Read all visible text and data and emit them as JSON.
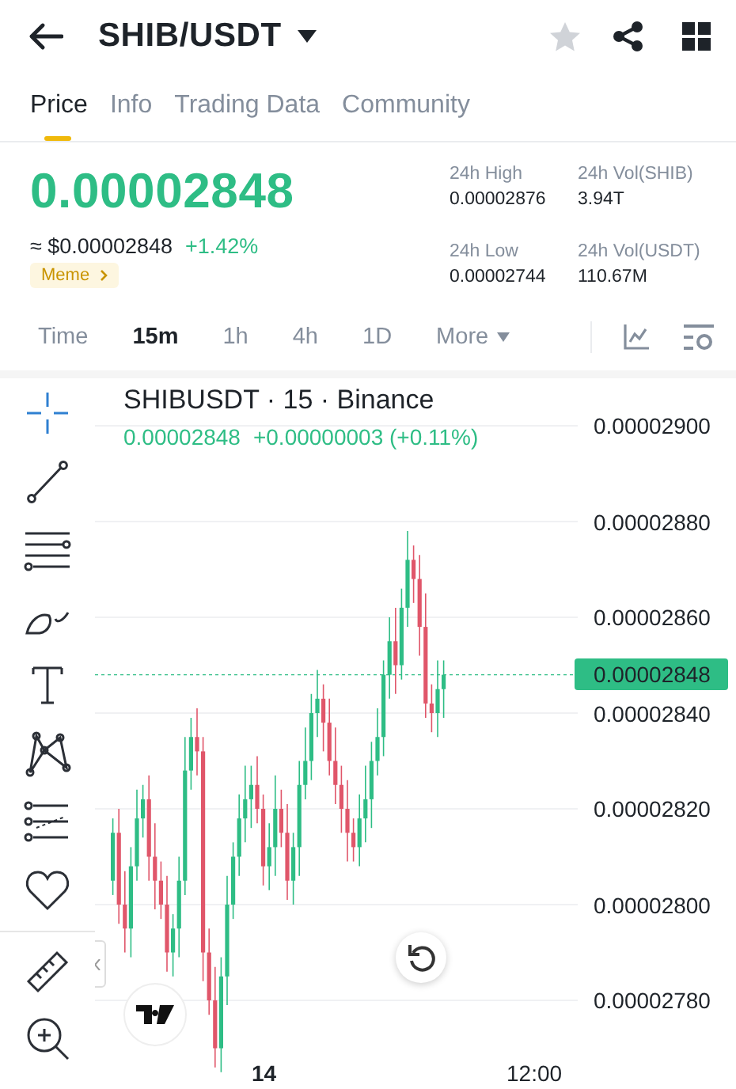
{
  "header": {
    "title": "SHIB/USDT",
    "favorite": false
  },
  "tabs": [
    {
      "label": "Price",
      "selected": true
    },
    {
      "label": "Info",
      "selected": false
    },
    {
      "label": "Trading Data",
      "selected": false
    },
    {
      "label": "Community",
      "selected": false
    }
  ],
  "price": {
    "last": "0.00002848",
    "fiat": "≈ $0.00002848",
    "change": "+1.42%",
    "tag": "Meme"
  },
  "stats": [
    {
      "label": "24h High",
      "value": "0.00002876"
    },
    {
      "label": "24h Vol(SHIB)",
      "value": "3.94T"
    },
    {
      "label": "24h Low",
      "value": "0.00002744"
    },
    {
      "label": "24h Vol(USDT)",
      "value": "110.67M"
    }
  ],
  "intervals": [
    {
      "label": "Time",
      "selected": false
    },
    {
      "label": "15m",
      "selected": true
    },
    {
      "label": "1h",
      "selected": false
    },
    {
      "label": "4h",
      "selected": false
    },
    {
      "label": "1D",
      "selected": false
    },
    {
      "label": "More",
      "selected": false
    }
  ],
  "chart": {
    "title": "SHIBUSDT · 15 · Binance",
    "last": "0.00002848",
    "change": "+0.00000003 (+0.11%)",
    "price_axis": [
      "0.00002900",
      "0.00002880",
      "0.00002860",
      "0.00002840",
      "0.00002820",
      "0.00002800",
      "0.00002780"
    ],
    "current_price": "0.00002848",
    "time_axis": [
      "14",
      "12:00"
    ],
    "tools": [
      {
        "kind": "crosshair",
        "selected": true
      },
      {
        "kind": "trendline",
        "selected": false
      },
      {
        "kind": "channel",
        "selected": false
      },
      {
        "kind": "brush",
        "selected": false
      },
      {
        "kind": "text",
        "selected": false
      },
      {
        "kind": "pattern",
        "selected": false
      },
      {
        "kind": "fib",
        "selected": false
      },
      {
        "kind": "favorite",
        "selected": false
      },
      {
        "kind": "ruler",
        "selected": false
      },
      {
        "kind": "zoom",
        "selected": false
      }
    ]
  }
}
